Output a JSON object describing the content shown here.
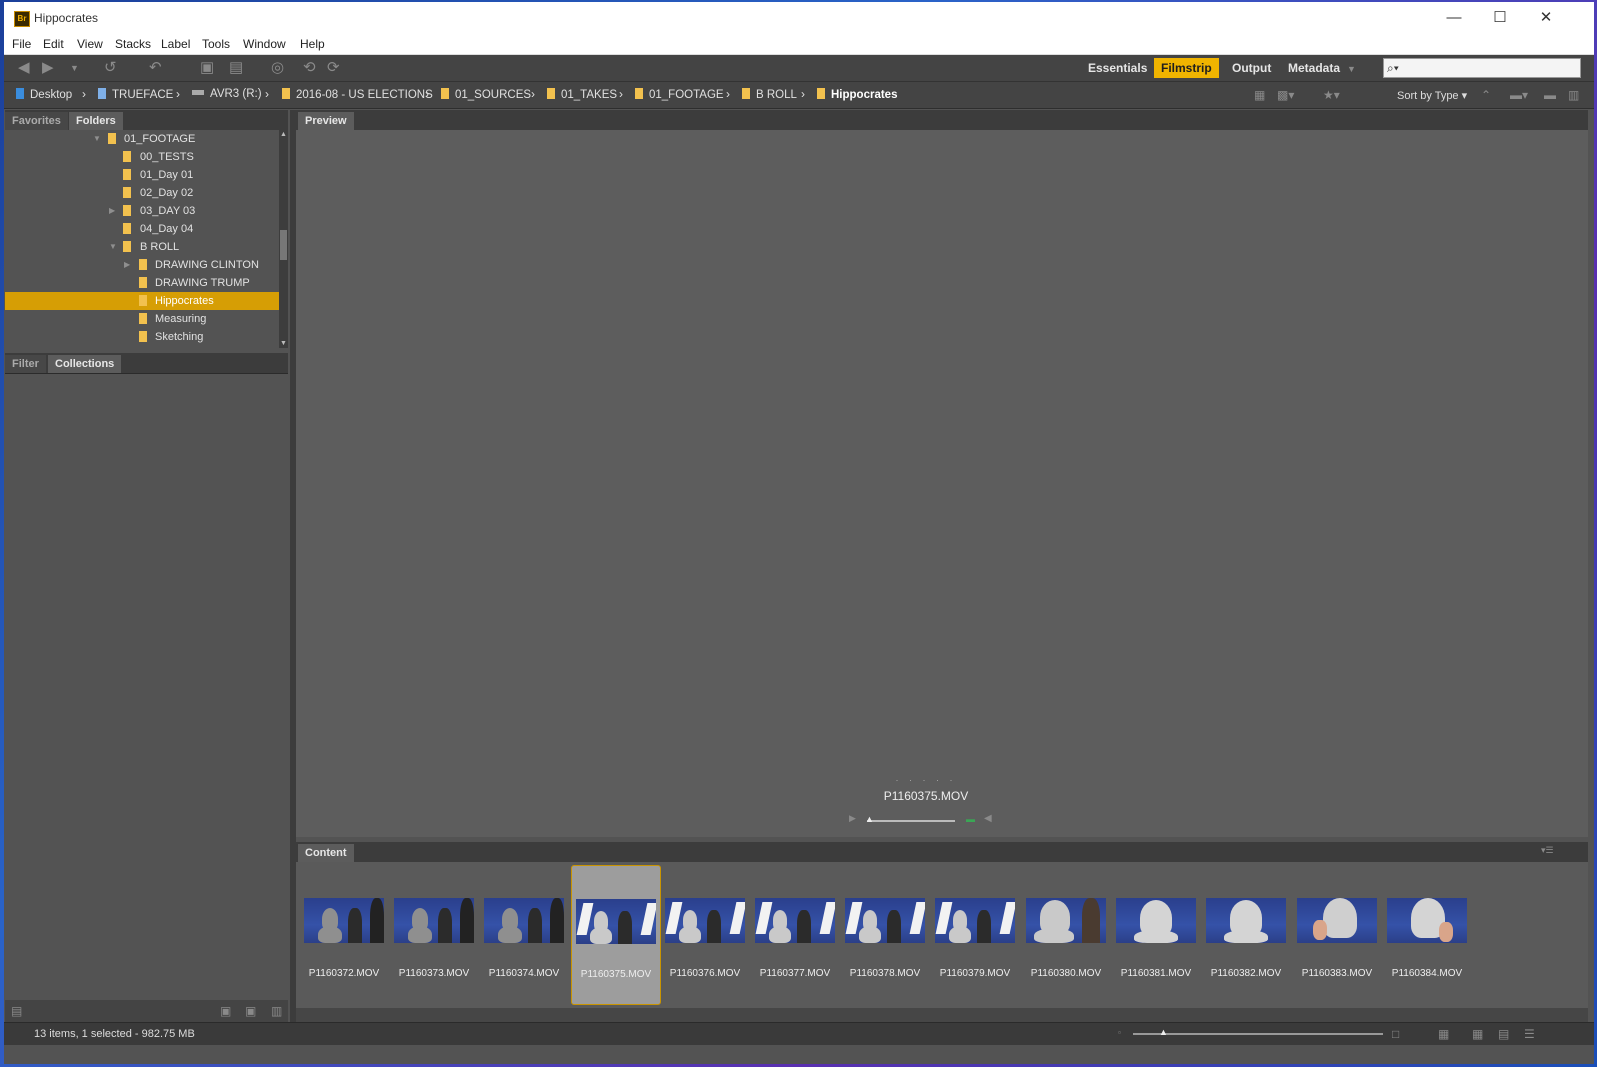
{
  "window": {
    "title": "Hippocrates",
    "app_icon": "Br",
    "minimize": "—",
    "maximize": "☐",
    "close": "✕"
  },
  "menu": [
    "File",
    "Edit",
    "View",
    "Stacks",
    "Label",
    "Tools",
    "Window",
    "Help"
  ],
  "workspaces": {
    "essentials": "Essentials",
    "filmstrip": "Filmstrip",
    "output": "Output",
    "metadata": "Metadata"
  },
  "search": {
    "placeholder": ""
  },
  "breadcrumbs": [
    "Desktop",
    "TRUEFACE",
    "AVR3 (R:)",
    "2016-08 - US ELECTIONS",
    "01_SOURCES",
    "01_TAKES",
    "01_FOOTAGE",
    "B ROLL",
    "Hippocrates"
  ],
  "sort_label": "Sort by Type",
  "panels": {
    "favorites": "Favorites",
    "folders": "Folders",
    "filter": "Filter",
    "collections": "Collections",
    "preview": "Preview",
    "content": "Content"
  },
  "folder_tree": [
    {
      "label": "01_FOOTAGE"
    },
    {
      "label": "00_TESTS"
    },
    {
      "label": "01_Day 01"
    },
    {
      "label": "02_Day 02"
    },
    {
      "label": "03_DAY 03"
    },
    {
      "label": "04_Day 04"
    },
    {
      "label": "B ROLL"
    },
    {
      "label": "DRAWING CLINTON"
    },
    {
      "label": "DRAWING TRUMP"
    },
    {
      "label": "Hippocrates"
    },
    {
      "label": "Measuring"
    },
    {
      "label": "Sketching"
    }
  ],
  "preview": {
    "filename": "P1160375.MOV",
    "dots": "· · · · ·"
  },
  "content_items": [
    {
      "name": "P1160372.MOV"
    },
    {
      "name": "P1160373.MOV"
    },
    {
      "name": "P1160374.MOV"
    },
    {
      "name": "P1160375.MOV"
    },
    {
      "name": "P1160376.MOV"
    },
    {
      "name": "P1160377.MOV"
    },
    {
      "name": "P1160378.MOV"
    },
    {
      "name": "P1160379.MOV"
    },
    {
      "name": "P1160380.MOV"
    },
    {
      "name": "P1160381.MOV"
    },
    {
      "name": "P1160382.MOV"
    },
    {
      "name": "P1160383.MOV"
    },
    {
      "name": "P1160384.MOV"
    }
  ],
  "status": {
    "text": "13 items, 1 selected - 982.75 MB"
  },
  "colors": {
    "accent": "#f0b400",
    "selection": "#d69e05",
    "panel": "#535353"
  }
}
